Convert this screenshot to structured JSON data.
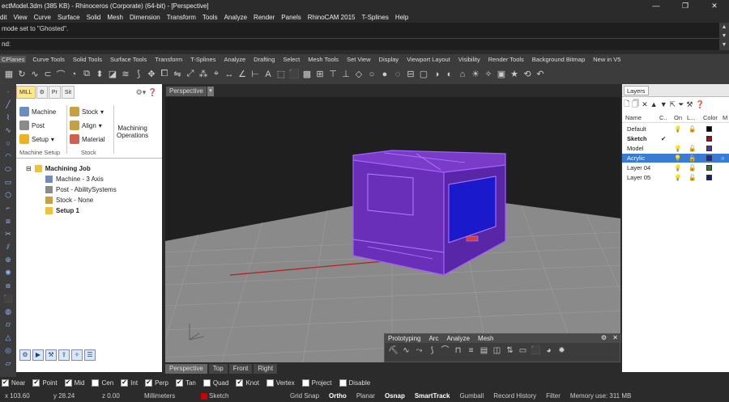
{
  "window": {
    "title": "ectModel.3dm (385 KB) - Rhinoceros (Corporate) (64-bit) - [Perspective]",
    "min": "—",
    "max": "❐",
    "close": "✕"
  },
  "menu": [
    "dit",
    "View",
    "Curve",
    "Surface",
    "Solid",
    "Mesh",
    "Dimension",
    "Transform",
    "Tools",
    "Analyze",
    "Render",
    "Panels",
    "RhinoCAM 2015",
    "T-Splines",
    "Help"
  ],
  "history": {
    "line": "mode set to \"Ghosted\"."
  },
  "command": {
    "prompt": "nd:"
  },
  "tabs": [
    "CPlanes",
    "Curve Tools",
    "Solid Tools",
    "Surface Tools",
    "Transform",
    "T-Splines",
    "Analyze",
    "Drafting",
    "Select",
    "Mesh Tools",
    "Set View",
    "Display",
    "Viewport Layout",
    "Visibility",
    "Render Tools",
    "Background Bitmap",
    "New in V5"
  ],
  "left_panel": {
    "tabs": [
      "MILL",
      "",
      "Pr",
      "Sit"
    ],
    "ribbon": {
      "machine": "Machine",
      "post": "Post",
      "setup": "Setup",
      "stock": "Stock",
      "align": "Align",
      "material": "Material",
      "machining_ops": "Machining",
      "machining_ops2": "Operations",
      "group1": "Machine Setup",
      "group2": "Stock"
    },
    "tree": {
      "root": "Machining Job",
      "machine": "Machine - 3 Axis",
      "post": "Post - AbilitySystems",
      "stock": "Stock - None",
      "setup": "Setup 1"
    }
  },
  "viewport": {
    "name": "Perspective",
    "tabs": [
      "Perspective",
      "Top",
      "Front",
      "Right"
    ],
    "axis_x": "x",
    "axis_y": "y",
    "axis_z": "z"
  },
  "floating_toolbar": {
    "tabs": [
      "Prototyping",
      "Arc",
      "Analyze",
      "Mesh"
    ]
  },
  "layers": {
    "title": "Layers",
    "columns": [
      "Name",
      "C..",
      "On",
      "L...",
      "Color",
      "M"
    ],
    "rows": [
      {
        "name": "Default",
        "current": "",
        "color": "#000000",
        "selected": false
      },
      {
        "name": "Sketch",
        "current": "✔",
        "color": "#c00000",
        "selected": false
      },
      {
        "name": "Model",
        "current": "",
        "color": "#5a2fa0",
        "selected": false
      },
      {
        "name": "Acrylic",
        "current": "",
        "color": "#1f1fd0",
        "selected": true
      },
      {
        "name": "Layer 04",
        "current": "",
        "color": "#1c8a1c",
        "selected": false
      },
      {
        "name": "Layer 05",
        "current": "",
        "color": "#1a1a8a",
        "selected": false
      }
    ]
  },
  "osnap": [
    {
      "label": "Near",
      "on": true
    },
    {
      "label": "Point",
      "on": true
    },
    {
      "label": "Mid",
      "on": true
    },
    {
      "label": "Cen",
      "on": false
    },
    {
      "label": "Int",
      "on": true
    },
    {
      "label": "Perp",
      "on": true
    },
    {
      "label": "Tan",
      "on": true
    },
    {
      "label": "Quad",
      "on": false
    },
    {
      "label": "Knot",
      "on": true
    },
    {
      "label": "Vertex",
      "on": false
    },
    {
      "label": "Project",
      "on": false
    },
    {
      "label": "Disable",
      "on": false
    }
  ],
  "status": {
    "x": "x 103.60",
    "y": "y 28.24",
    "z": "z 0.00",
    "units": "Millimeters",
    "layer": "Sketch",
    "grid_snap": "Grid Snap",
    "ortho": "Ortho",
    "planar": "Planar",
    "osnap": "Osnap",
    "smarttrack": "SmartTrack",
    "gumball": "Gumball",
    "record_history": "Record History",
    "filter": "Filter",
    "memory": "Memory use: 311 MB"
  }
}
